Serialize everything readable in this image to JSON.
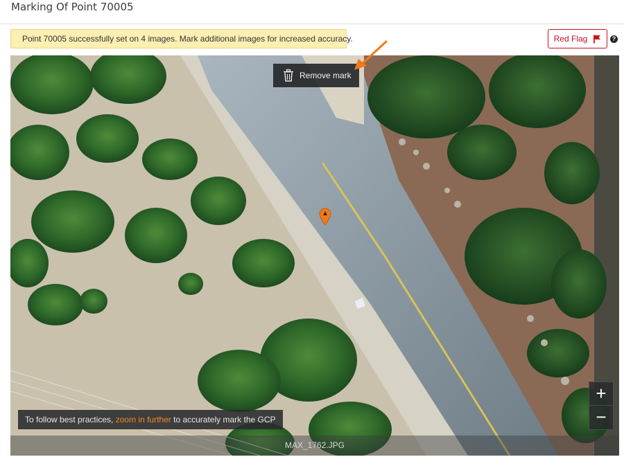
{
  "page": {
    "title": "Marking Of Point 70005"
  },
  "banner": {
    "message": "Point 70005 successfully set on 4 images. Mark additional images for increased accuracy."
  },
  "toolbar": {
    "red_flag_label": "Red Flag",
    "red_flag_icon": "flag-icon",
    "help_icon": "question-circle-icon",
    "help_glyph": "?"
  },
  "viewer": {
    "remove_mark_label": "Remove mark",
    "remove_mark_icon": "trash-icon",
    "zoom_in_label": "+",
    "zoom_out_label": "−",
    "hint_prefix": "To follow best practices, ",
    "hint_highlight": "zoom in further",
    "hint_suffix": " to accurately mark the GCP",
    "filename": "MAX_1762.JPG",
    "marker_icon": "map-pin-icon"
  },
  "colors": {
    "banner_bg": "#fbefb2",
    "red_flag": "#c8101e",
    "accent_orange": "#f08a24",
    "marker": "#f07a1a"
  }
}
